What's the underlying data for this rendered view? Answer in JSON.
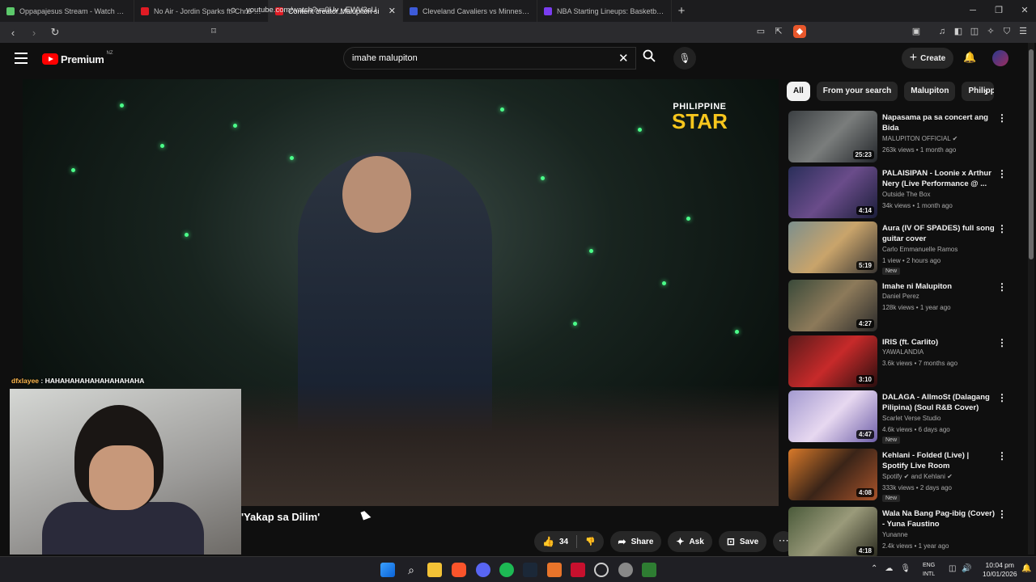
{
  "browser": {
    "tabs": [
      {
        "title": "Oppapajesus Stream - Watch Live on",
        "fav": "#5cc96b"
      },
      {
        "title": "No Air - Jordin Sparks ft. Chris Brown",
        "fav": "#e01b24"
      },
      {
        "title": "Content creator Malupiton si",
        "fav": "#e01b24",
        "active": true
      },
      {
        "title": "Cleveland Cavaliers vs Minnesota Tim",
        "fav": "#3d5bd9"
      },
      {
        "title": "NBA Starting Lineups: Basketball Da",
        "fav": "#7a3df0"
      }
    ],
    "new_tab": "+",
    "url": "youtube.com/watch?v=0Uv_-EWV3cU"
  },
  "yt": {
    "logo_text": "Premium",
    "logo_region": "NZ",
    "search_value": "imahe malupiton",
    "create_label": "Create"
  },
  "video": {
    "brand_line1": "PHILIPPINE",
    "brand_line2": "STAR",
    "chat_name": "dfxlayee",
    "chat_text": " : HAHAHAHAHAHAHAHAHAHA",
    "title": "'Yakap sa Dilim'",
    "like_count": "34",
    "share_label": "Share",
    "ask_label": "Ask",
    "save_label": "Save"
  },
  "chips": [
    "All",
    "From your search",
    "Malupiton",
    "Philipp"
  ],
  "recs": [
    {
      "title": "Napasama pa sa concert ang Bida",
      "channel": "MALUPITON OFFICIAL ✔",
      "meta": "263k views • 1 month ago",
      "dur": "25:23",
      "new": ""
    },
    {
      "title": "PALAISIPAN - Loonie x Arthur Nery (Live Performance @ ...",
      "channel": "Outside The Box",
      "meta": "34k views • 1 month ago",
      "dur": "4:14",
      "new": ""
    },
    {
      "title": "Aura (IV OF SPADES) full song guitar cover",
      "channel": "Carlo Emmanuelle Ramos",
      "meta": "1 view • 2 hours ago",
      "dur": "5:19",
      "new": "New"
    },
    {
      "title": "Imahe ni Malupiton",
      "channel": "Daniel Perez",
      "meta": "128k views • 1 year ago",
      "dur": "4:27",
      "new": ""
    },
    {
      "title": "IRIS (ft. Carlito)",
      "channel": "YAWALANDIA",
      "meta": "3.6k views • 7 months ago",
      "dur": "3:10",
      "new": ""
    },
    {
      "title": "DALAGA - AllmoSt (Dalagang Pilipina) (Soul R&B Cover)",
      "channel": "Scarlet Verse Studio",
      "meta": "4.6k views • 6 days ago",
      "dur": "4:47",
      "new": "New"
    },
    {
      "title": "Kehlani - Folded (Live) | Spotify Live Room",
      "channel": "Spotify ✔ and Kehlani ✔",
      "meta": "333k views • 2 days ago",
      "dur": "4:08",
      "new": "New"
    },
    {
      "title": "Wala Na Bang Pag-ibig (Cover) - Yuna Faustino",
      "channel": "Yunanne",
      "meta": "2.4k views • 1 year ago",
      "dur": "4:18",
      "new": ""
    }
  ],
  "taskbar": {
    "lang1": "ENG",
    "lang2": "INTL",
    "time": "10:04 pm",
    "date": "10/01/2026"
  }
}
